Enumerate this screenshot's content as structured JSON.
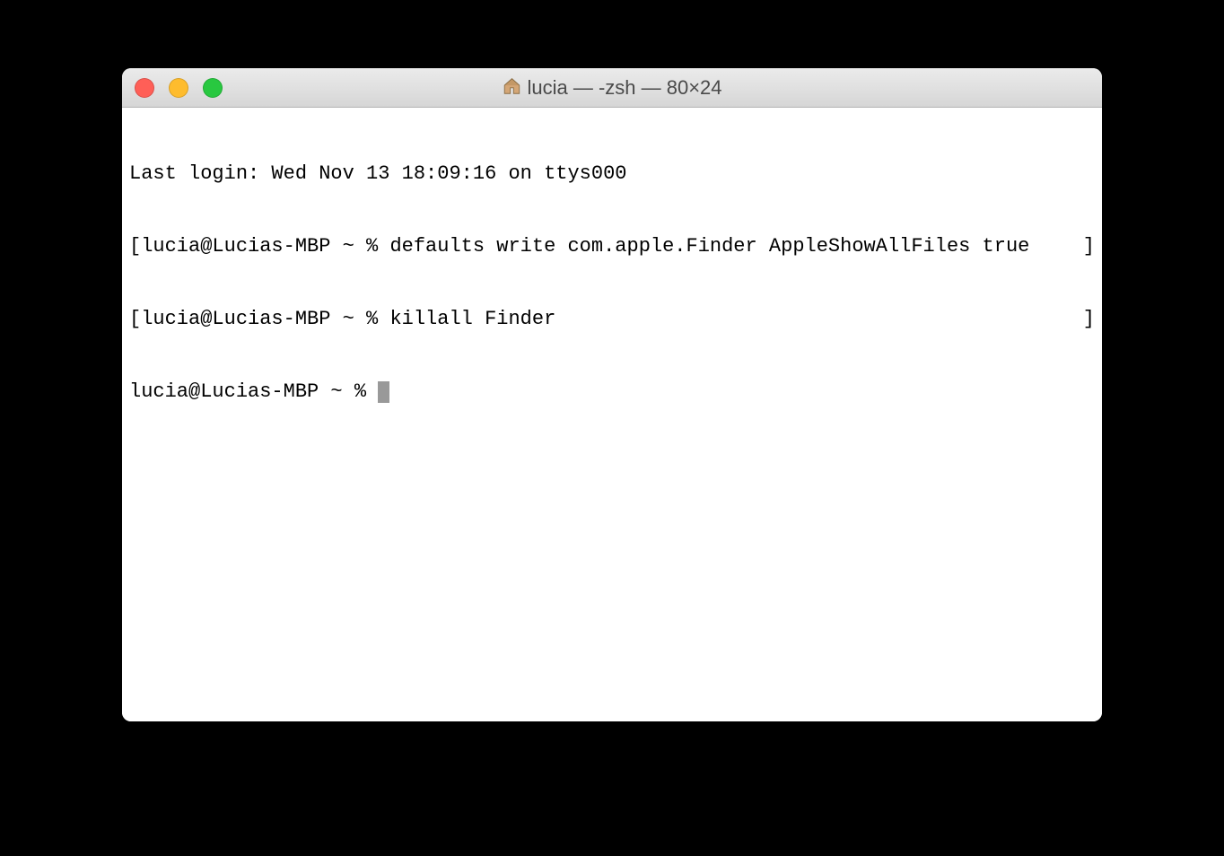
{
  "window": {
    "title": "lucia — -zsh — 80×24"
  },
  "terminal": {
    "lines": {
      "line1": "Last login: Wed Nov 13 18:09:16 on ttys000",
      "line2_left": "[lucia@Lucias-MBP ~ % defaults write com.apple.Finder AppleShowAllFiles true",
      "line2_right": "]",
      "line3_left": "[lucia@Lucias-MBP ~ % killall Finder",
      "line3_right": "]",
      "line4_prompt": "lucia@Lucias-MBP ~ % "
    }
  }
}
